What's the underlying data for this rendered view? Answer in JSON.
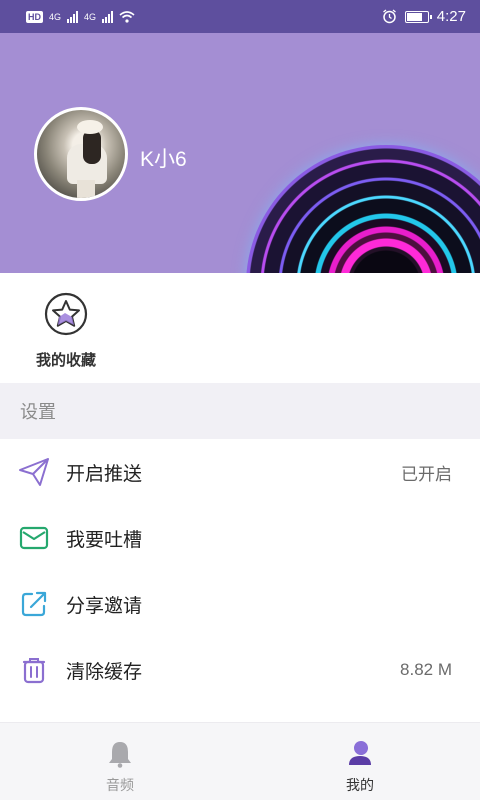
{
  "status_bar": {
    "chip": "HD",
    "net1": "4G",
    "net2": "4G",
    "time": "4:27",
    "battery_level": 0.8
  },
  "profile": {
    "username": "K小6"
  },
  "favorites": {
    "label": "我的收藏",
    "icon": "star-badge-icon"
  },
  "settings": {
    "header": "设置",
    "items": [
      {
        "icon": "send-icon",
        "label": "开启推送",
        "value": "已开启"
      },
      {
        "icon": "mail-icon",
        "label": "我要吐槽",
        "value": ""
      },
      {
        "icon": "share-icon",
        "label": "分享邀请",
        "value": ""
      },
      {
        "icon": "trash-icon",
        "label": "清除缓存",
        "value": "8.82 M"
      }
    ]
  },
  "bottom_nav": {
    "items": [
      {
        "label": "音频",
        "icon": "bell-icon",
        "active": false
      },
      {
        "label": "我的",
        "icon": "person-icon",
        "active": true
      }
    ],
    "active_color": "#6a4fb3",
    "inactive_color": "#9a9a9a"
  },
  "colors": {
    "status_bar": "#5e4f9e",
    "header": "#a48ed3",
    "accent": "#7b62c7"
  }
}
